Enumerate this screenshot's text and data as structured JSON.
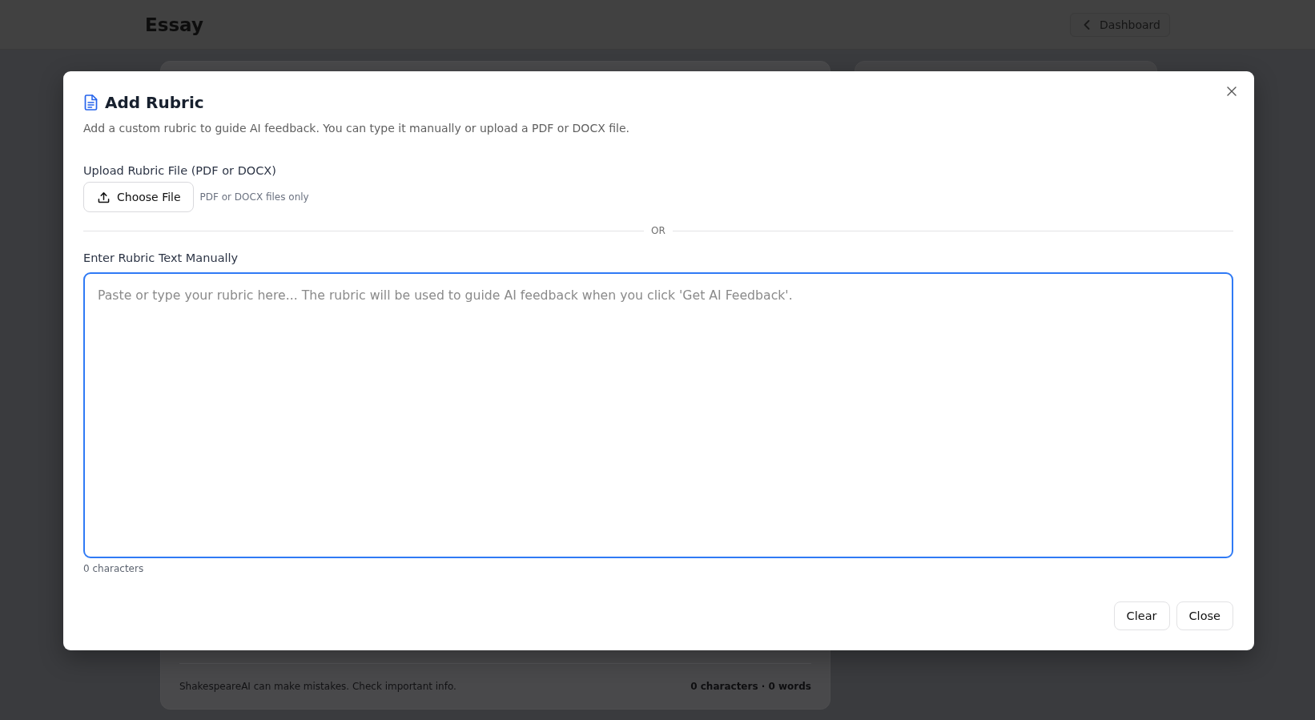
{
  "page": {
    "title": "Essay",
    "back_button": "Dashboard"
  },
  "essay_card": {
    "footer_note": "ShakespeareAI can make mistakes. Check important info.",
    "counts": "0 characters · 0 words"
  },
  "dialog": {
    "title": "Add Rubric",
    "description": "Add a custom rubric to guide AI feedback. You can type it manually or upload a PDF or DOCX file.",
    "upload": {
      "label": "Upload Rubric File (PDF or DOCX)",
      "button": "Choose File",
      "hint": "PDF or DOCX files only"
    },
    "divider": "OR",
    "manual": {
      "label": "Enter Rubric Text Manually",
      "placeholder": "Paste or type your rubric here... The rubric will be used to guide AI feedback when you click 'Get AI Feedback'.",
      "focused": true,
      "counter": "0 characters"
    },
    "buttons": [
      "Clear",
      "Close"
    ]
  }
}
